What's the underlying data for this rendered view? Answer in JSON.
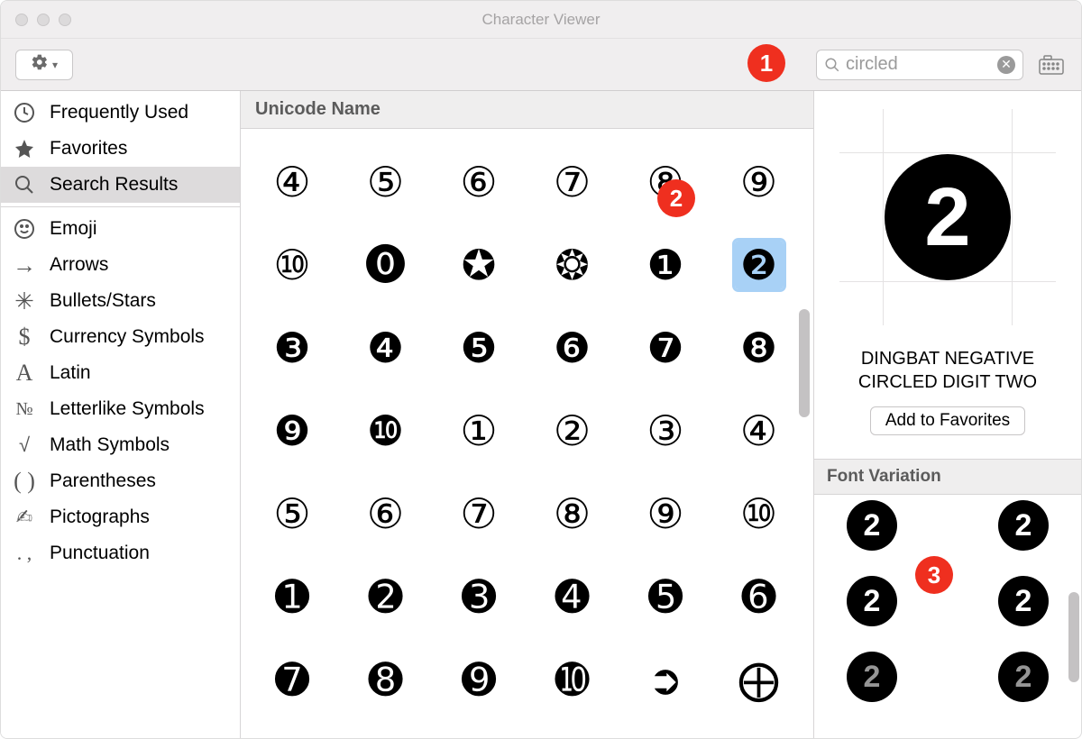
{
  "window": {
    "title": "Character Viewer"
  },
  "toolbar": {
    "search_value": "circled"
  },
  "sidebar": {
    "group1": [
      {
        "icon": "clock",
        "label": "Frequently Used"
      },
      {
        "icon": "star",
        "label": "Favorites"
      },
      {
        "icon": "search",
        "label": "Search Results",
        "selected": true
      }
    ],
    "group2": [
      {
        "icon": "emoji",
        "label": "Emoji"
      },
      {
        "icon": "arrow",
        "label": "Arrows"
      },
      {
        "icon": "bullets",
        "label": "Bullets/Stars"
      },
      {
        "icon": "dollar",
        "label": "Currency Symbols"
      },
      {
        "icon": "latin",
        "label": "Latin"
      },
      {
        "icon": "numero",
        "label": "Letterlike Symbols"
      },
      {
        "icon": "sqrt",
        "label": "Math Symbols"
      },
      {
        "icon": "parens",
        "label": "Parentheses"
      },
      {
        "icon": "picto",
        "label": "Pictographs"
      },
      {
        "icon": "punct",
        "label": "Punctuation"
      }
    ]
  },
  "grid": {
    "header": "Unicode Name",
    "selected_index": 11,
    "glyphs": [
      "④",
      "⑤",
      "⑥",
      "⑦",
      "⑧",
      "⑨",
      "⑩",
      "⓿",
      "✪",
      "❂",
      "❶",
      "❷",
      "❸",
      "❹",
      "❺",
      "❻",
      "❼",
      "❽",
      "❾",
      "❿",
      "①",
      "②",
      "③",
      "④",
      "⑤",
      "⑥",
      "⑦",
      "⑧",
      "⑨",
      "⑩",
      "➊",
      "➋",
      "➌",
      "➍",
      "➎",
      "➏",
      "➐",
      "➑",
      "➒",
      "➓",
      "➲",
      "⨁"
    ]
  },
  "detail": {
    "preview_text": "2",
    "char_name": "DINGBAT NEGATIVE CIRCLED DIGIT TWO",
    "fav_button": "Add to Favorites",
    "variation_header": "Font Variation",
    "variations": [
      "2",
      "2",
      "2",
      "2",
      "2",
      "2"
    ]
  },
  "callouts": {
    "c1": "1",
    "c2": "2",
    "c3": "3"
  }
}
